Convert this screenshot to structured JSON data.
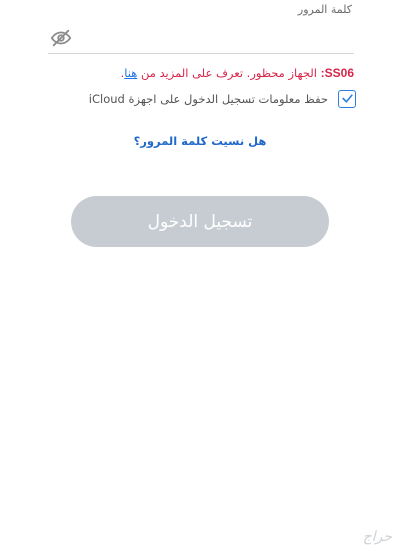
{
  "password": {
    "label": "كلمة المرور",
    "value": "",
    "placeholder": ""
  },
  "icons": {
    "visibility_toggle": "eye-slash-icon",
    "checkbox_mark": "checkmark-icon"
  },
  "error": {
    "code": "SS06:",
    "message": "الجهاز محظور. تعرف على المزيد من",
    "link_text": "هنا",
    "trailing": "."
  },
  "remember": {
    "label": "حفظ معلومات تسجيل الدخول على اجهزة iCloud",
    "checked": true
  },
  "forgot_password": "هل نسيت كلمة المرور؟",
  "login_button": "تسجيل الدخول",
  "watermark": "حراج",
  "colors": {
    "error": "#d6254a",
    "link": "#1a73e8",
    "accent": "#2d7fe0",
    "button_disabled": "#c7ccd3"
  }
}
